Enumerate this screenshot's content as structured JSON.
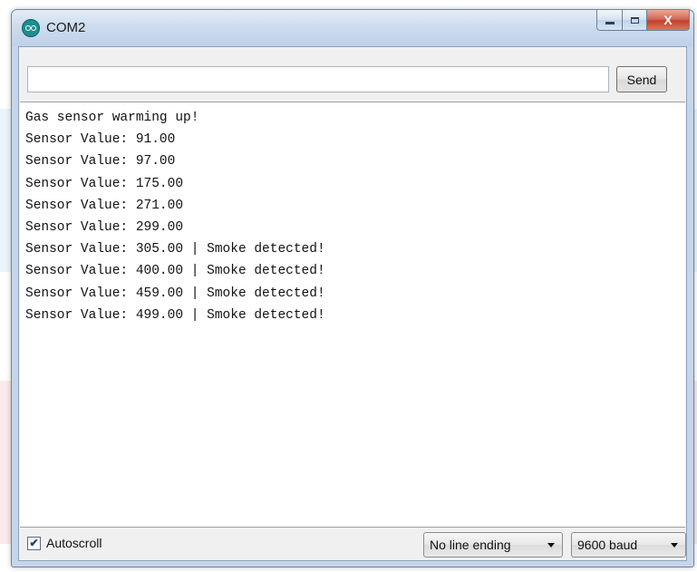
{
  "window": {
    "title": "COM2",
    "close_glyph": "X"
  },
  "input": {
    "value": "",
    "placeholder": ""
  },
  "toolbar": {
    "send_label": "Send"
  },
  "output": {
    "lines": [
      "Gas sensor warming up!",
      "Sensor Value: 91.00",
      "Sensor Value: 97.00",
      "Sensor Value: 175.00",
      "Sensor Value: 271.00",
      "Sensor Value: 299.00",
      "Sensor Value: 305.00 | Smoke detected!",
      "Sensor Value: 400.00 | Smoke detected!",
      "Sensor Value: 459.00 | Smoke detected!",
      "Sensor Value: 499.00 | Smoke detected!"
    ]
  },
  "footer": {
    "autoscroll_label": "Autoscroll",
    "autoscroll_checked": true,
    "line_ending": "No line ending",
    "baud_rate": "9600 baud"
  },
  "icons": {
    "app": "arduino-icon",
    "minimize": "minimize-icon",
    "maximize": "maximize-icon",
    "close": "close-icon",
    "dropdown": "chevron-down-icon"
  },
  "colors": {
    "close_button": "#c2402e",
    "app_icon": "#1e8e91",
    "titlebar": "#cddcee"
  }
}
